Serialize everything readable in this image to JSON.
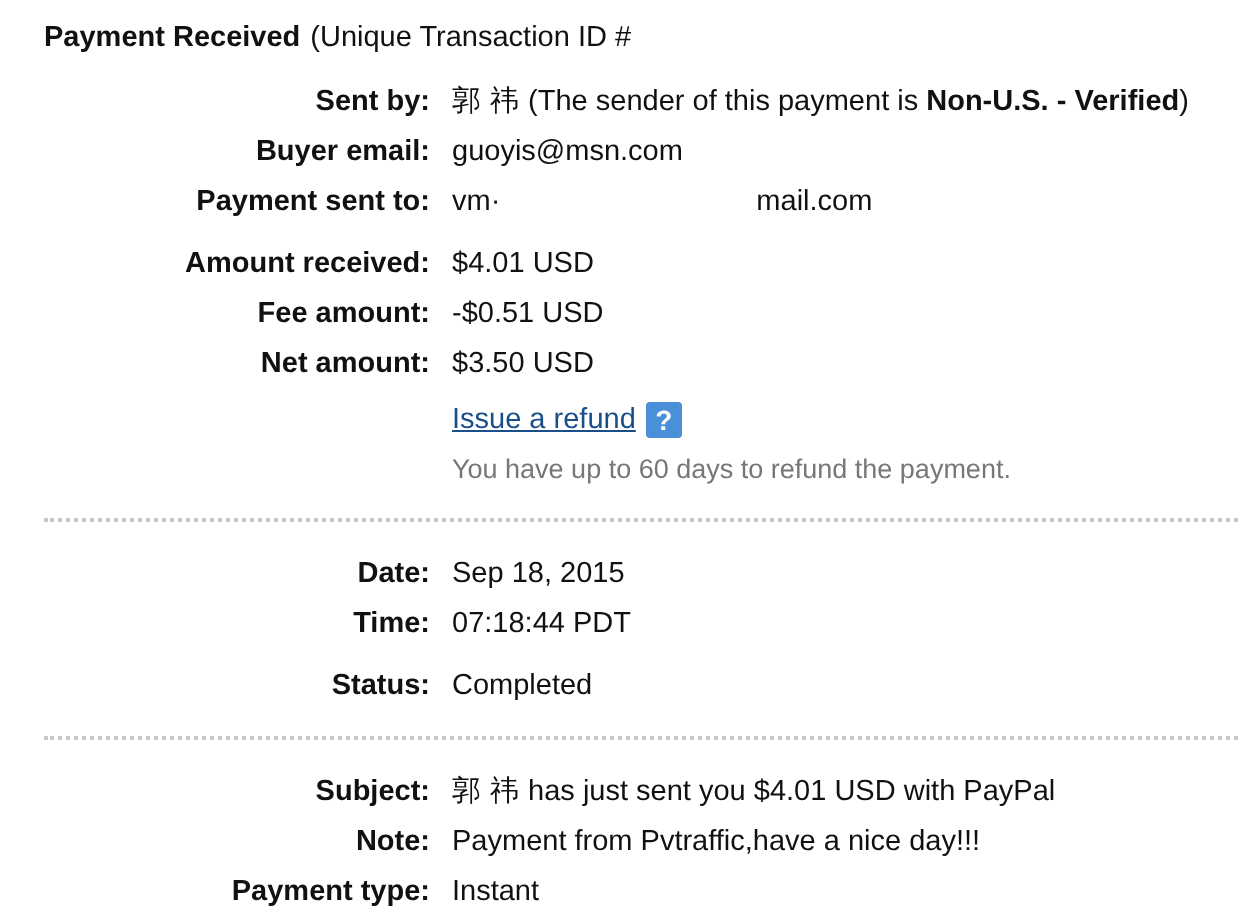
{
  "title": {
    "heading": "Payment Received",
    "detail": "(Unique Transaction ID #"
  },
  "sections": [
    {
      "groups": [
        [
          {
            "label": "Sent by:",
            "parts": [
              "郭 祎 (The sender of this payment is **Non-U.S. - Verified**)"
            ]
          },
          {
            "label": "Buyer email:",
            "parts": [
              "guoyis@msn.com"
            ]
          },
          {
            "label": "Payment sent to:",
            "parts": [
              "vm·",
              "mail.com"
            ]
          }
        ],
        [
          {
            "label": "Amount received:",
            "parts": [
              "$4.01 USD"
            ]
          },
          {
            "label": "Fee amount:",
            "parts": [
              "-$0.51 USD"
            ]
          },
          {
            "label": "Net amount:",
            "parts": [
              "$3.50 USD"
            ]
          }
        ]
      ],
      "refund": {
        "link": "Issue a refund",
        "help": "?",
        "note": "You have up to 60 days to refund the payment."
      }
    },
    {
      "groups": [
        [
          {
            "label": "Date:",
            "parts": [
              "Sep 18, 2015"
            ]
          },
          {
            "label": "Time:",
            "parts": [
              "07:18:44 PDT"
            ]
          }
        ],
        [
          {
            "label": "Status:",
            "parts": [
              "Completed"
            ]
          }
        ]
      ]
    },
    {
      "groups": [
        [
          {
            "label": "Subject:",
            "parts": [
              "郭 祎 has just sent you $4.01 USD with PayPal"
            ]
          },
          {
            "label": "Note:",
            "parts": [
              "Payment from Pvtraffic,have a nice day!!!"
            ]
          },
          {
            "label": "Payment type:",
            "parts": [
              "Instant"
            ]
          }
        ]
      ]
    }
  ]
}
